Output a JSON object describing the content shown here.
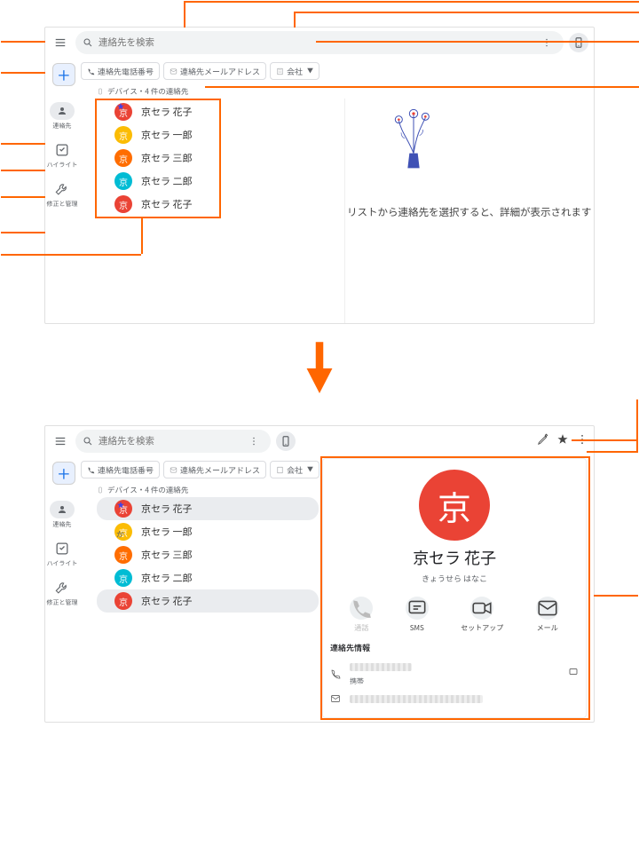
{
  "search": {
    "placeholder": "連絡先を検索"
  },
  "chips": {
    "phone": "連絡先電話番号",
    "email": "連絡先メールアドレス",
    "company": "会社"
  },
  "count": "デバイス・4 件の連絡先",
  "sidebar": {
    "contacts": "連絡先",
    "highlights": "ハイライト",
    "manage": "修正と管理"
  },
  "contacts_top": [
    {
      "avatar": "京",
      "name": "京セラ 花子",
      "color": "a-red"
    },
    {
      "avatar": "京",
      "name": "京セラ 一郎",
      "color": "a-yellow"
    },
    {
      "avatar": "京",
      "name": "京セラ 三郎",
      "color": "a-orange"
    },
    {
      "avatar": "京",
      "name": "京セラ 二郎",
      "color": "a-teal"
    },
    {
      "avatar": "京",
      "name": "京セラ 花子",
      "color": "a-red"
    }
  ],
  "empty_message": "リストから連絡先を選択すると、詳細が表示されます",
  "section_labels": {
    "ka": "か"
  },
  "detail": {
    "avatar": "京",
    "name": "京セラ 花子",
    "furigana": "きょうせら はなこ",
    "actions": {
      "call": "通話",
      "sms": "SMS",
      "setup": "セットアップ",
      "mail": "メール"
    },
    "info_header": "連絡先情報",
    "mobile_label": "携帯"
  }
}
